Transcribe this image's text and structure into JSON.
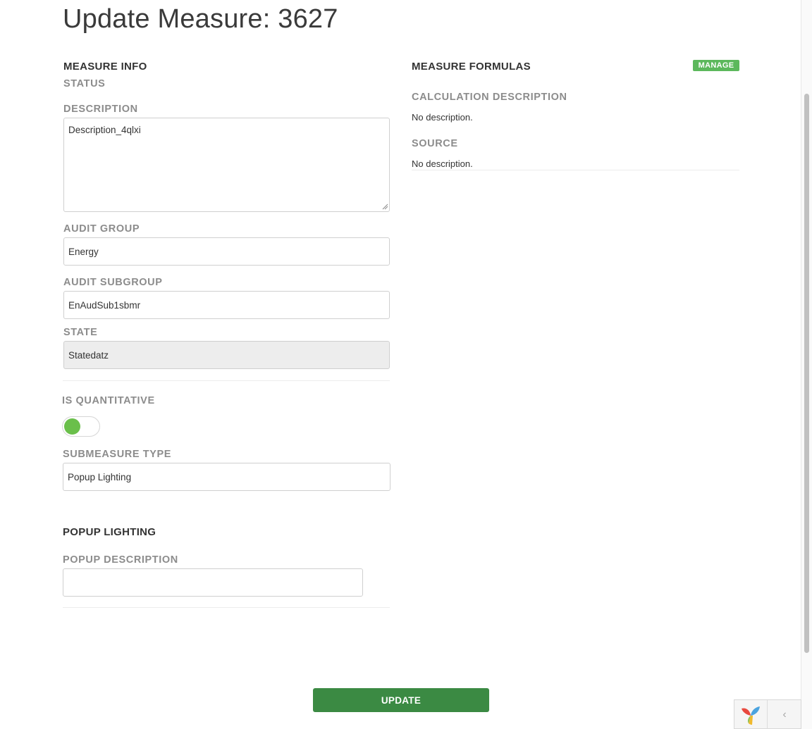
{
  "page": {
    "title": "Update Measure: 3627"
  },
  "measure_info": {
    "title": "MEASURE INFO",
    "status_label": "STATUS",
    "description_label": "DESCRIPTION",
    "description_value": "Description_4qlxi",
    "audit_group_label": "AUDIT GROUP",
    "audit_group_value": "Energy",
    "audit_subgroup_label": "AUDIT SUBGROUP",
    "audit_subgroup_value": "EnAudSub1sbmr",
    "state_label": "STATE",
    "state_value": "Statedatz"
  },
  "quantitative": {
    "label": "IS QUANTITATIVE",
    "enabled": true,
    "color": "#6abf4b"
  },
  "submeasure": {
    "type_label": "SUBMEASURE TYPE",
    "type_value": "Popup Lighting"
  },
  "popup_lighting": {
    "title": "POPUP LIGHTING",
    "description_label": "POPUP DESCRIPTION",
    "description_value": ""
  },
  "measure_formulas": {
    "title": "MEASURE FORMULAS",
    "manage_label": "MANAGE",
    "calc_description_label": "CALCULATION DESCRIPTION",
    "calc_description_value": "No description.",
    "source_label": "SOURCE",
    "source_value": "No description."
  },
  "actions": {
    "update_label": "UPDATE"
  },
  "colors": {
    "primary_button": "#3b8a43",
    "manage_badge": "#5cb85c",
    "label_gray": "#8c8c8c"
  },
  "debug_toolbar": {
    "logo_icon": "yii-logo-icon",
    "toggle_icon": "chevron-left-icon",
    "toggle_glyph": "‹"
  }
}
